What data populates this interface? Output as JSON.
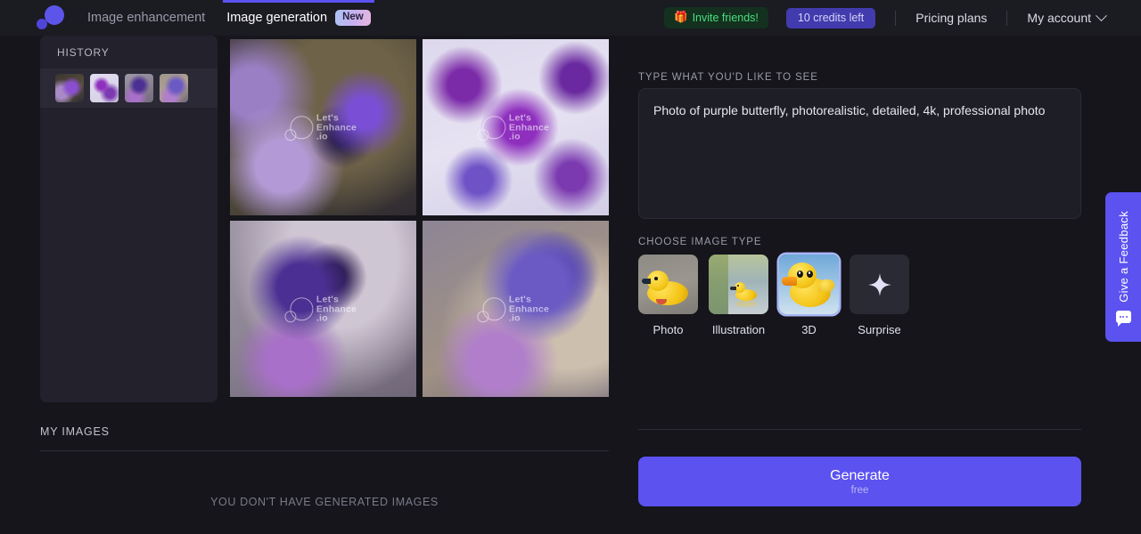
{
  "header": {
    "logo_name": "lets-enhance-logo",
    "tabs": [
      {
        "label": "Image enhancement",
        "active": false
      },
      {
        "label": "Image generation",
        "active": true,
        "badge": "New"
      }
    ],
    "invite": {
      "icon": "gift-icon",
      "glyph": "🎁",
      "label": "Invite friends!"
    },
    "credits": "10 credits left",
    "pricing": "Pricing plans",
    "account": "My account"
  },
  "history": {
    "title": "HISTORY",
    "items": [
      {
        "name": "history-thumb-1",
        "alt": "purple butterfly on lilac flowers"
      },
      {
        "name": "history-thumb-2",
        "alt": "many purple butterflies pattern"
      },
      {
        "name": "history-thumb-3",
        "alt": "purple butterfly side view"
      },
      {
        "name": "history-thumb-4",
        "alt": "purple butterfly on flower"
      }
    ]
  },
  "grid": {
    "watermark": {
      "line1": "Let's",
      "line2": "Enhance",
      "line3": ".io"
    },
    "images": [
      {
        "name": "generated-image-1",
        "alt": "purple butterfly on lavender, golden bokeh"
      },
      {
        "name": "generated-image-2",
        "alt": "many purple butterflies on light background"
      },
      {
        "name": "generated-image-3",
        "alt": "spotted purple butterfly on flower"
      },
      {
        "name": "generated-image-4",
        "alt": "purple butterfly on lilac bloom"
      }
    ]
  },
  "my_images": {
    "title": "MY IMAGES",
    "empty_message": "YOU DON'T HAVE GENERATED IMAGES"
  },
  "prompt": {
    "label": "TYPE WHAT YOU'D LIKE TO SEE",
    "value": "Photo of purple butterfly, photorealistic, detailed, 4k, professional photo",
    "placeholder": "Type what you'd like to see"
  },
  "image_type": {
    "label": "CHOOSE IMAGE TYPE",
    "options": [
      {
        "label": "Photo",
        "selected": false,
        "thumb": "duck-photo"
      },
      {
        "label": "Illustration",
        "selected": false,
        "thumb": "duck-illustration"
      },
      {
        "label": "3D",
        "selected": true,
        "thumb": "duck-3d"
      },
      {
        "label": "Surprise",
        "selected": false,
        "thumb": "sparkle-icon"
      }
    ]
  },
  "generate": {
    "label": "Generate",
    "sub_label": "free"
  },
  "feedback": {
    "label": "Give a Feedback",
    "icon": "speech-bubble-icon"
  },
  "colors": {
    "page_bg": "#15151b",
    "header_bg": "#1b1b22",
    "panel_bg": "#22212c",
    "accent": "#5b52f0",
    "credits_bg": "#413bae",
    "invite_bg": "#13311e",
    "invite_text": "#4ade80",
    "selected_border": "#a9b6f5"
  }
}
